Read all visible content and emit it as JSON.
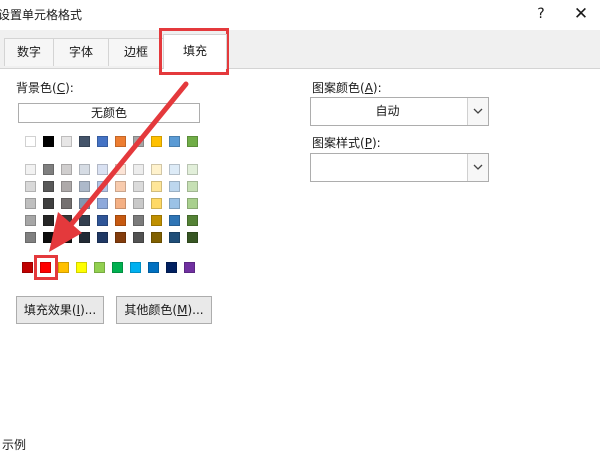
{
  "window": {
    "title": "设置单元格格式",
    "help": "?",
    "close": "✕"
  },
  "tabs": [
    "数字",
    "字体",
    "边框",
    "填充"
  ],
  "active_tab": "填充",
  "background": {
    "label_prefix": "背景色(",
    "label_key": "C",
    "label_suffix": "):",
    "no_color": "无颜色",
    "theme_top_row": [
      "#ffffff",
      "#000000",
      "#e7e6e6",
      "#44546a",
      "#4472c4",
      "#ed7d31",
      "#a5a5a5",
      "#ffc000",
      "#5b9bd5",
      "#70ad47"
    ],
    "theme_shades": [
      [
        "#f2f2f2",
        "#7f7f7f",
        "#d0cece",
        "#d6dce4",
        "#d9e1f2",
        "#fce4d6",
        "#ededed",
        "#fff2cc",
        "#ddebf7",
        "#e2efda"
      ],
      [
        "#d9d9d9",
        "#595959",
        "#aeaaaa",
        "#adb9ca",
        "#b4c6e7",
        "#f8cbad",
        "#dbdbdb",
        "#ffe699",
        "#bdd7ee",
        "#c6e0b4"
      ],
      [
        "#bfbfbf",
        "#404040",
        "#757171",
        "#8497b0",
        "#8ea9db",
        "#f4b084",
        "#c9c9c9",
        "#ffd966",
        "#9bc2e6",
        "#a9d08e"
      ],
      [
        "#a6a6a6",
        "#262626",
        "#3a3838",
        "#333f4f",
        "#2f5597",
        "#c65911",
        "#7b7b7b",
        "#bf8f00",
        "#2f75b5",
        "#548235"
      ],
      [
        "#808080",
        "#0d0d0d",
        "#171616",
        "#222b35",
        "#1f3864",
        "#833c0c",
        "#525252",
        "#806000",
        "#1f4e78",
        "#375623"
      ]
    ],
    "standard_colors": [
      "#c00000",
      "#ff0000",
      "#ffc000",
      "#ffff00",
      "#92d050",
      "#00b050",
      "#00b0f0",
      "#0070c0",
      "#002060",
      "#7030a0"
    ],
    "selected_standard": "#ff0000",
    "fill_effects": {
      "text": "填充效果",
      "key": "I",
      "tail": ")..."
    },
    "more_colors": {
      "text": "其他颜色",
      "key": "M",
      "tail": ")..."
    }
  },
  "pattern_color": {
    "label_prefix": "图案颜色(",
    "label_key": "A",
    "label_suffix": "):",
    "value": "自动"
  },
  "pattern_style": {
    "label_prefix": "图案样式(",
    "label_key": "P",
    "label_suffix": "):",
    "value": ""
  },
  "sample_label": "示例",
  "colors": {
    "annotation": "#e4393c"
  },
  "icons": [
    "help-icon",
    "close-icon",
    "chevron-down-icon"
  ]
}
